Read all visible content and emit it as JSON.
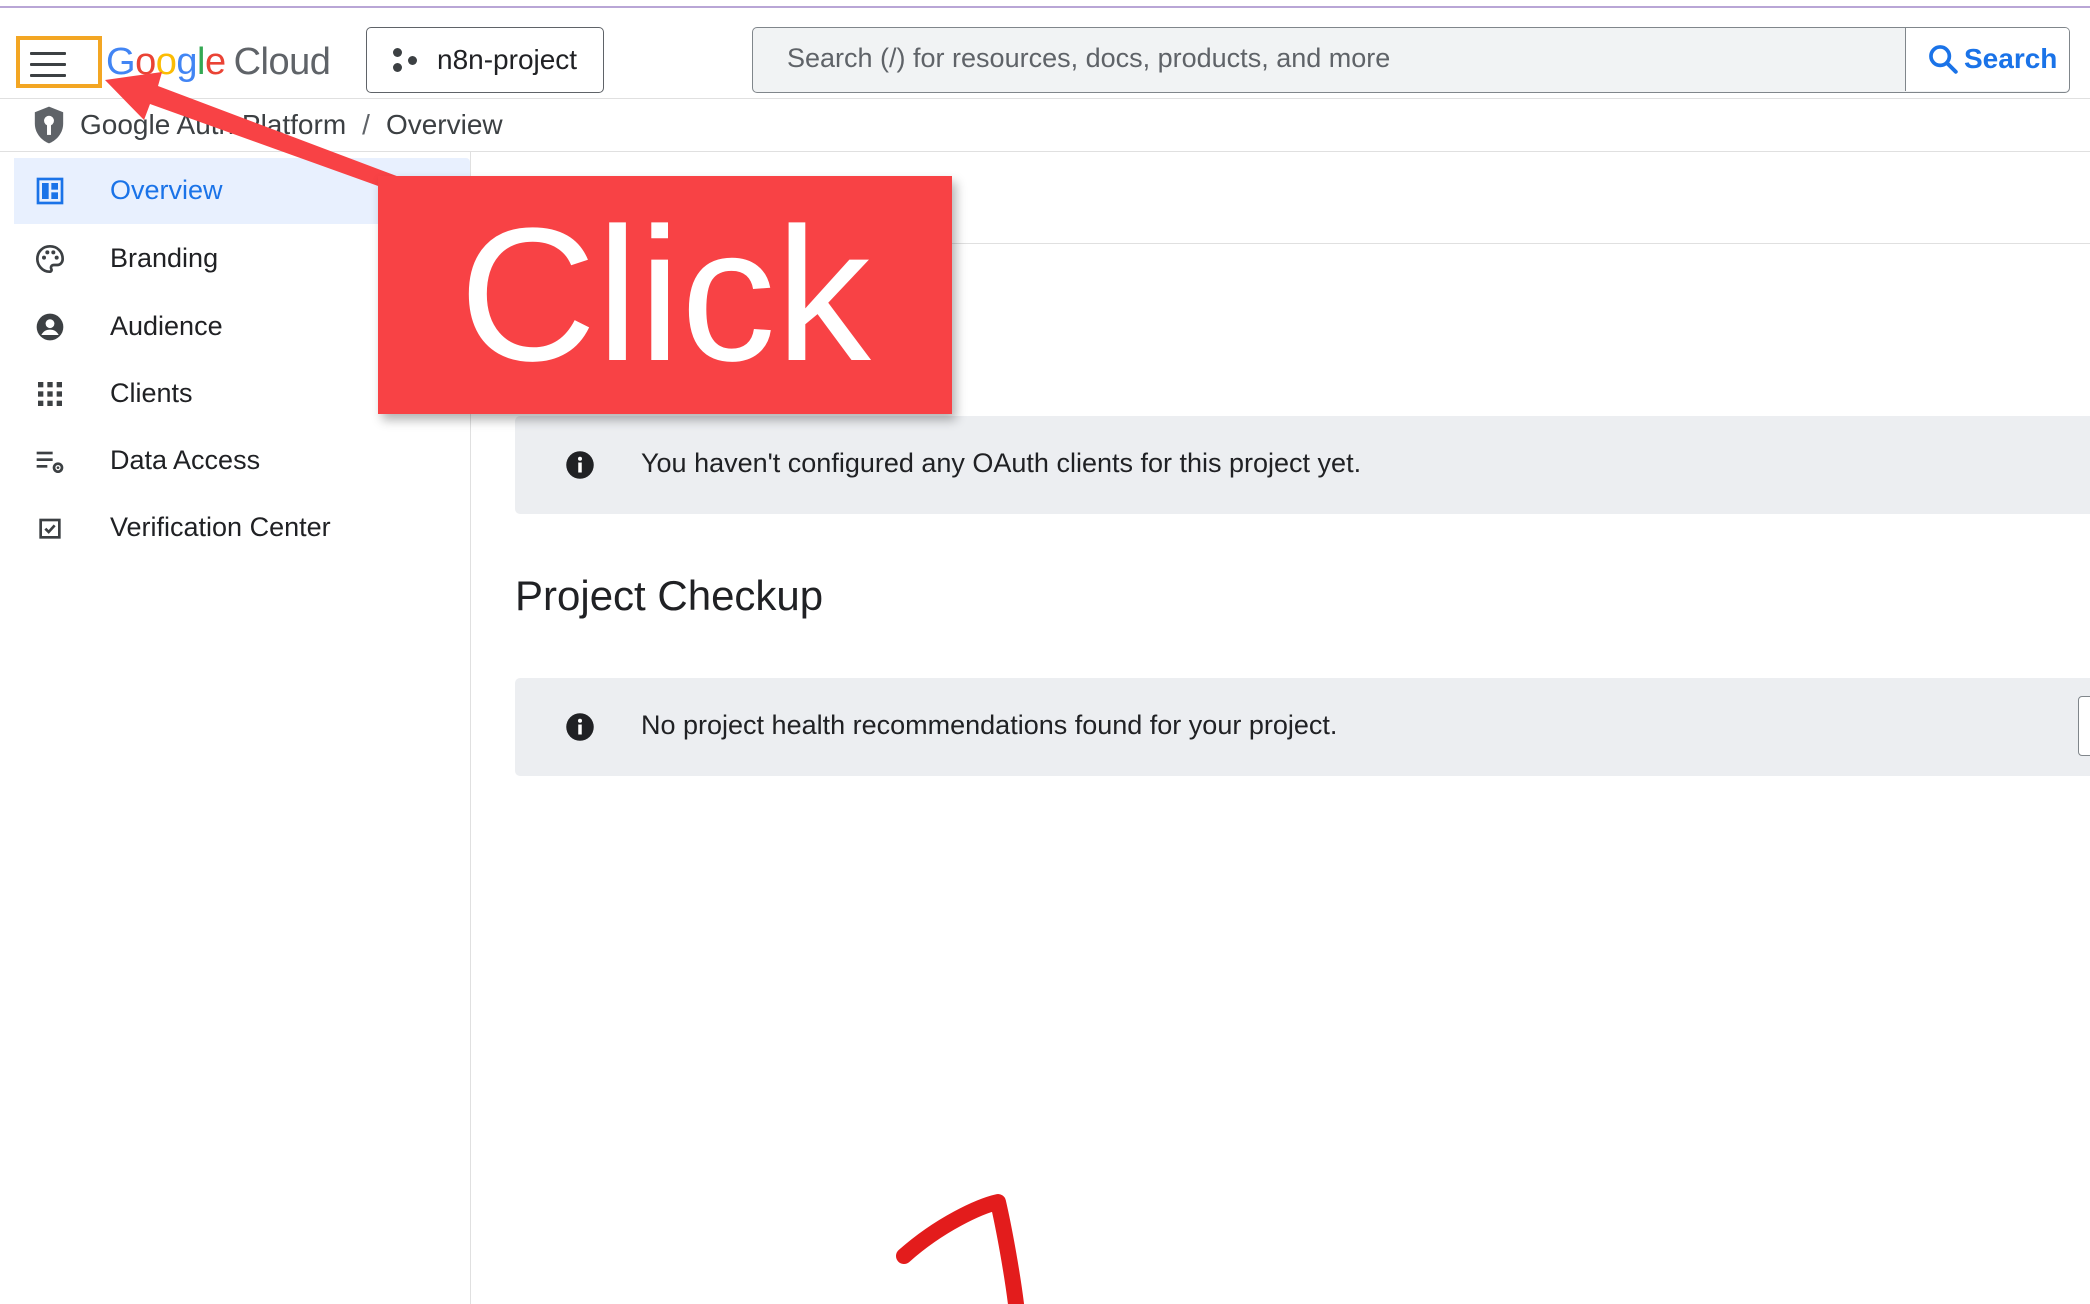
{
  "header": {
    "logo": {
      "g1": "G",
      "o1": "o",
      "o2": "o",
      "g2": "g",
      "l": "l",
      "e": "e",
      "cloud": "Cloud"
    },
    "project_label": "n8n-project",
    "search_placeholder": "Search (/) for resources, docs, products, and more",
    "search_button": "Search"
  },
  "breadcrumb": {
    "part1": "Google Auth Platform",
    "separator": "/",
    "part2": "Overview"
  },
  "sidebar": {
    "items": [
      {
        "label": "Overview",
        "icon": "dashboard-icon",
        "active": true
      },
      {
        "label": "Branding",
        "icon": "palette-icon",
        "active": false
      },
      {
        "label": "Audience",
        "icon": "account-circle-icon",
        "active": false
      },
      {
        "label": "Clients",
        "icon": "apps-grid-icon",
        "active": false
      },
      {
        "label": "Data Access",
        "icon": "settings-list-icon",
        "active": false
      },
      {
        "label": "Verification Center",
        "icon": "checkbox-icon",
        "active": false
      }
    ]
  },
  "main": {
    "clients_message": "You haven't configured any OAuth clients for this project yet.",
    "checkup_title": "Project Checkup",
    "checkup_message": "No project health recommendations found for your project."
  },
  "annotation": {
    "banner_text": "Click",
    "banner_color": "#f84245",
    "highlight_color": "#f3a623"
  },
  "colors": {
    "accent": "#1a73e8",
    "active_bg": "#e8f0fe",
    "info_bg": "#eceef1"
  }
}
